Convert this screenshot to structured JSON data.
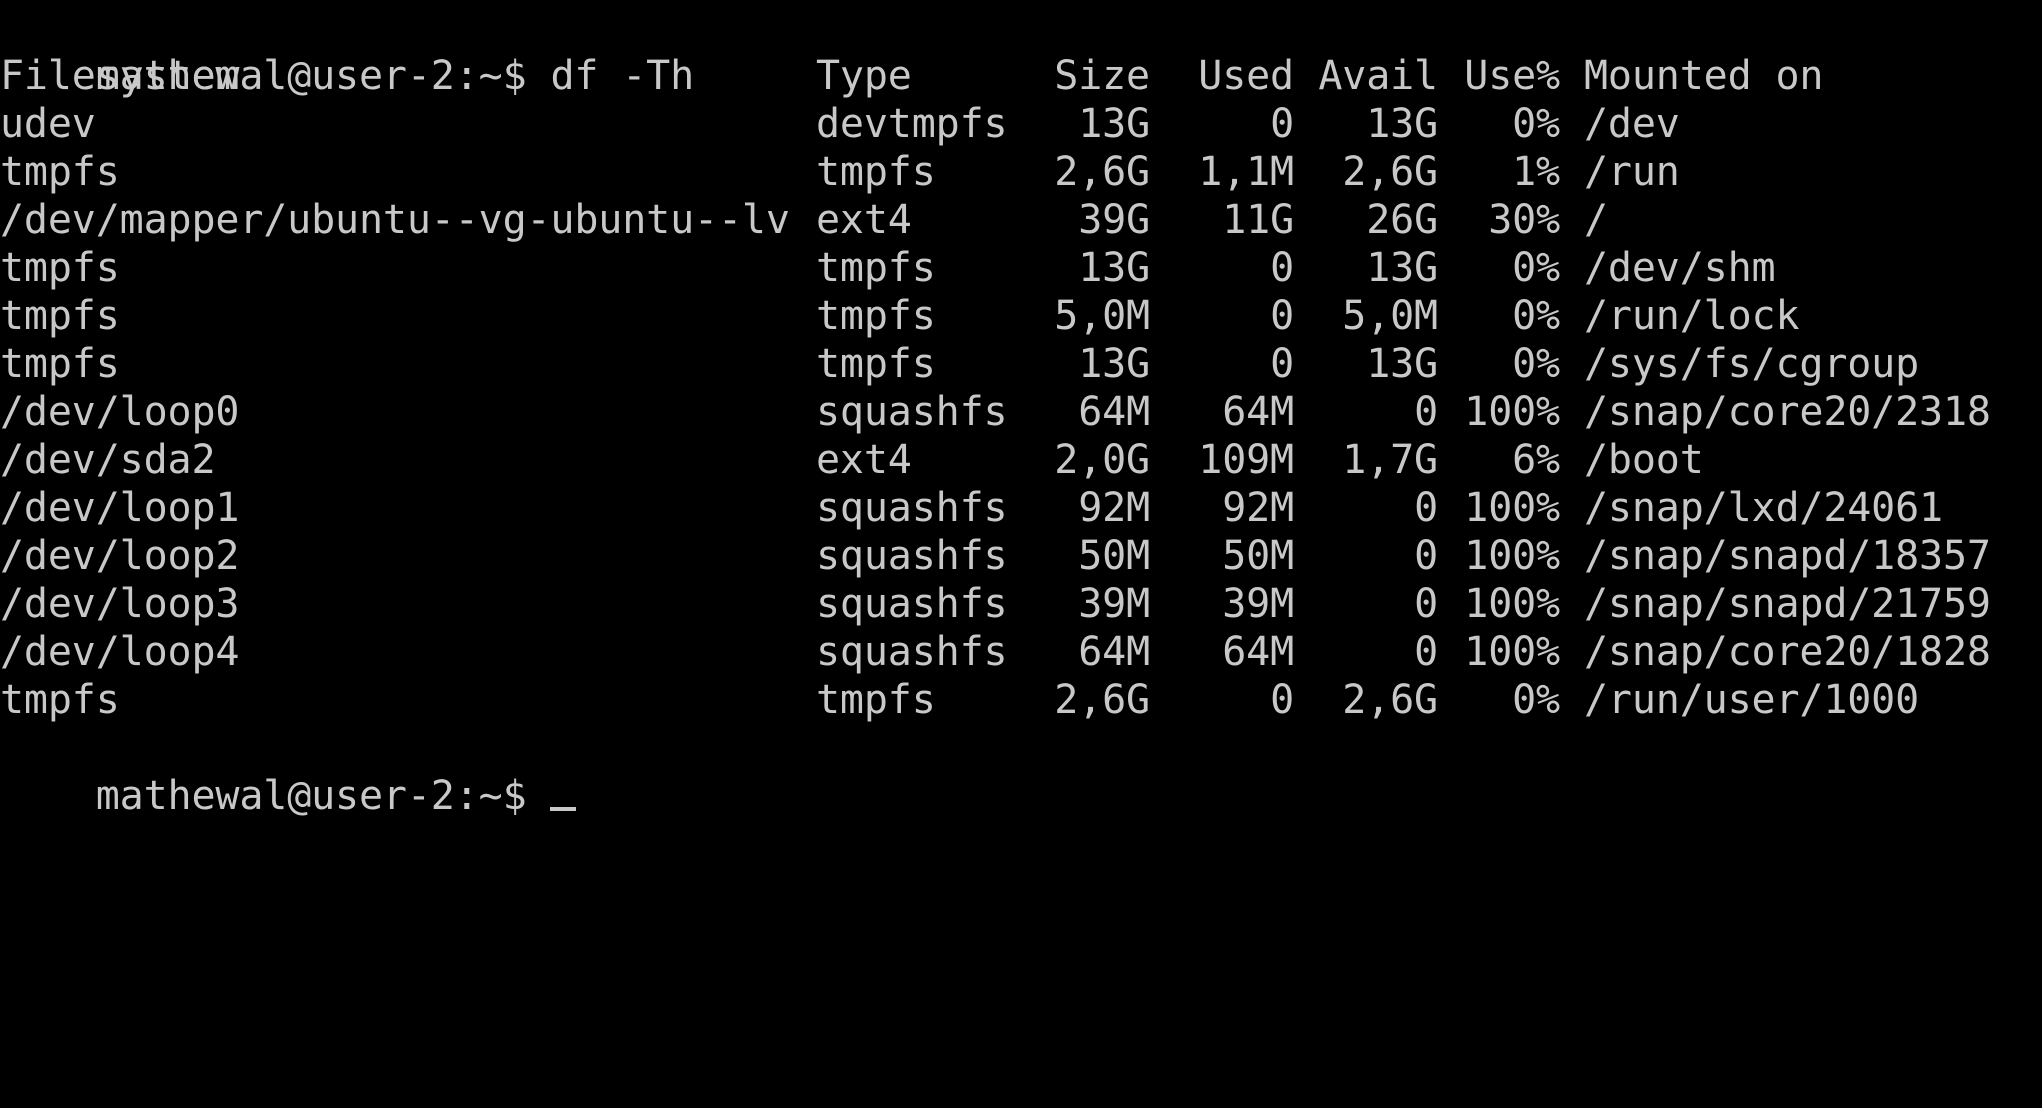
{
  "terminal": {
    "prompt": "mathewal@user-2:~$",
    "command": "df -Th",
    "headers": {
      "filesystem": "Filesystem",
      "type": "Type",
      "size": "Size",
      "used": "Used",
      "avail": "Avail",
      "use_pct": "Use%",
      "mounted_on": "Mounted on"
    },
    "rows": [
      {
        "filesystem": "udev",
        "type": "devtmpfs",
        "size": "13G",
        "used": "0",
        "avail": "13G",
        "use_pct": "0%",
        "mounted_on": "/dev"
      },
      {
        "filesystem": "tmpfs",
        "type": "tmpfs",
        "size": "2,6G",
        "used": "1,1M",
        "avail": "2,6G",
        "use_pct": "1%",
        "mounted_on": "/run"
      },
      {
        "filesystem": "/dev/mapper/ubuntu--vg-ubuntu--lv",
        "type": "ext4",
        "size": "39G",
        "used": "11G",
        "avail": "26G",
        "use_pct": "30%",
        "mounted_on": "/"
      },
      {
        "filesystem": "tmpfs",
        "type": "tmpfs",
        "size": "13G",
        "used": "0",
        "avail": "13G",
        "use_pct": "0%",
        "mounted_on": "/dev/shm"
      },
      {
        "filesystem": "tmpfs",
        "type": "tmpfs",
        "size": "5,0M",
        "used": "0",
        "avail": "5,0M",
        "use_pct": "0%",
        "mounted_on": "/run/lock"
      },
      {
        "filesystem": "tmpfs",
        "type": "tmpfs",
        "size": "13G",
        "used": "0",
        "avail": "13G",
        "use_pct": "0%",
        "mounted_on": "/sys/fs/cgroup"
      },
      {
        "filesystem": "/dev/loop0",
        "type": "squashfs",
        "size": "64M",
        "used": "64M",
        "avail": "0",
        "use_pct": "100%",
        "mounted_on": "/snap/core20/2318"
      },
      {
        "filesystem": "/dev/sda2",
        "type": "ext4",
        "size": "2,0G",
        "used": "109M",
        "avail": "1,7G",
        "use_pct": "6%",
        "mounted_on": "/boot"
      },
      {
        "filesystem": "/dev/loop1",
        "type": "squashfs",
        "size": "92M",
        "used": "92M",
        "avail": "0",
        "use_pct": "100%",
        "mounted_on": "/snap/lxd/24061"
      },
      {
        "filesystem": "/dev/loop2",
        "type": "squashfs",
        "size": "50M",
        "used": "50M",
        "avail": "0",
        "use_pct": "100%",
        "mounted_on": "/snap/snapd/18357"
      },
      {
        "filesystem": "/dev/loop3",
        "type": "squashfs",
        "size": "39M",
        "used": "39M",
        "avail": "0",
        "use_pct": "100%",
        "mounted_on": "/snap/snapd/21759"
      },
      {
        "filesystem": "/dev/loop4",
        "type": "squashfs",
        "size": "64M",
        "used": "64M",
        "avail": "0",
        "use_pct": "100%",
        "mounted_on": "/snap/core20/1828"
      },
      {
        "filesystem": "tmpfs",
        "type": "tmpfs",
        "size": "2,6G",
        "used": "0",
        "avail": "2,6G",
        "use_pct": "0%",
        "mounted_on": "/run/user/1000"
      }
    ],
    "final_prompt": "mathewal@user-2:~$"
  },
  "colors": {
    "background": "#000000",
    "foreground": "#c8c8c8"
  }
}
